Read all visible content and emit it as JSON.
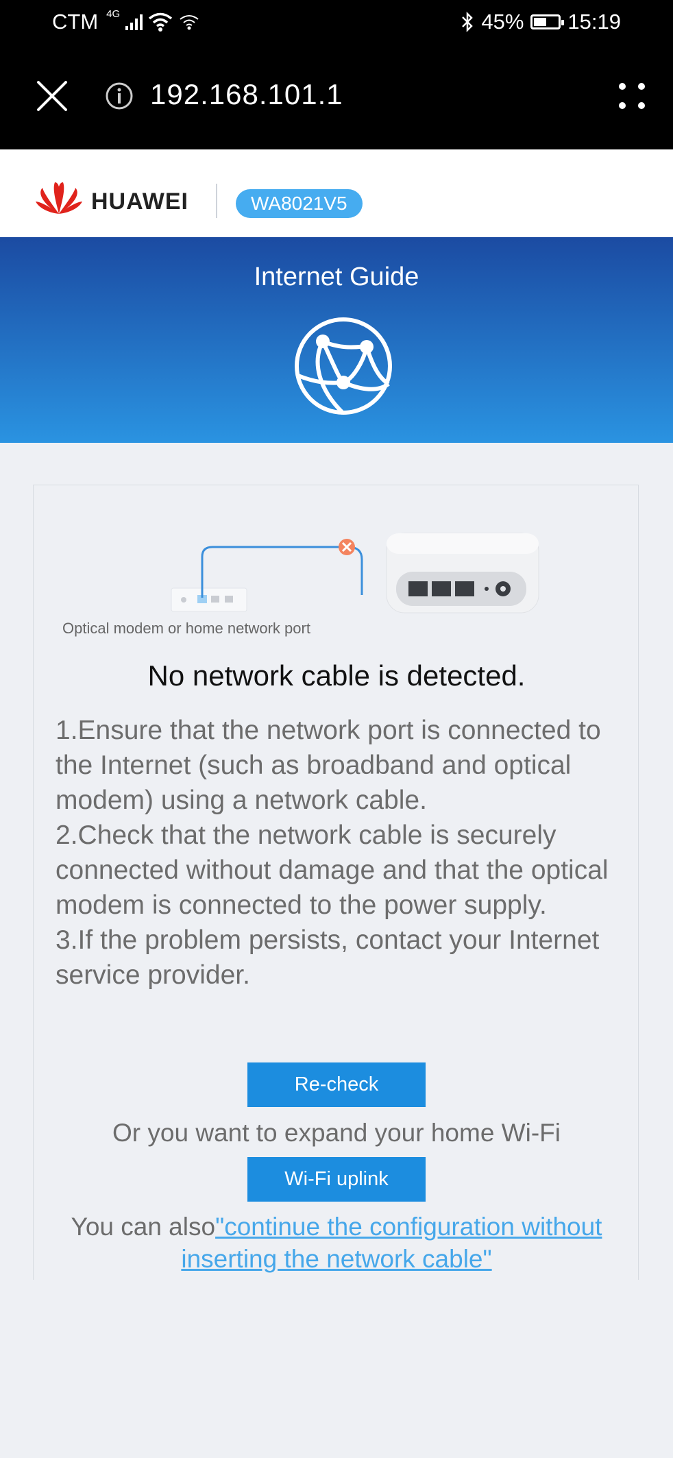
{
  "status_bar": {
    "carrier": "CTM",
    "network": "4G",
    "battery": "45%",
    "battery_level": 0.45,
    "time": "15:19"
  },
  "browser": {
    "url": "192.168.101.1",
    "icons": [
      "close-icon",
      "info-icon",
      "menu-icon"
    ]
  },
  "header": {
    "brand": "HUAWEI",
    "model": "WA8021V5",
    "brand_color": "#e0231c",
    "badge_color": "#46acf0"
  },
  "hero": {
    "title": "Internet Guide",
    "icon": "globe-icon"
  },
  "main": {
    "illustration_caption": "Optical modem or home network port",
    "headline": "No network cable is detected.",
    "instructions": [
      "1.Ensure that the network port is connected to the Internet (such as broadband and optical modem) using a network cable.",
      "2.Check that the network cable is securely connected without damage and that the optical modem is connected to the power supply.",
      "3.If the problem persists, contact your Internet service provider."
    ],
    "recheck_label": "Re-check",
    "expand_text": "Or you want to expand your home Wi-Fi",
    "wifi_uplink_label": "Wi-Fi uplink",
    "also_prefix": "You can also",
    "also_link": "\"continue the configuration without inserting the network cable\"",
    "accent_color": "#1c8ddf"
  }
}
